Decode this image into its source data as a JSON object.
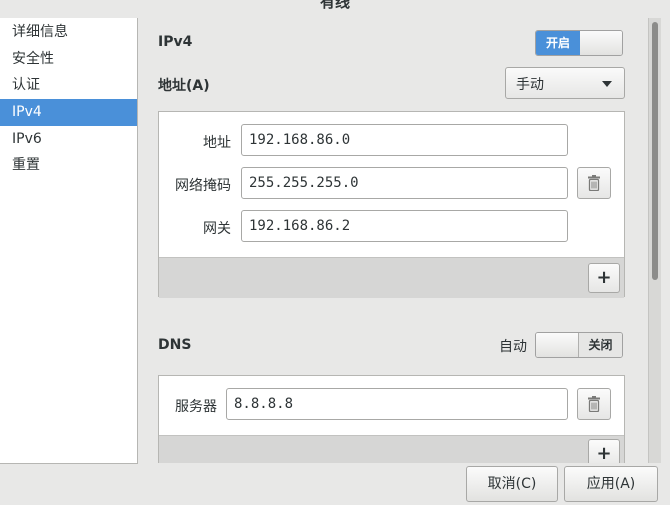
{
  "window": {
    "title": "有线"
  },
  "sidebar": {
    "items": [
      {
        "label": "详细信息",
        "selected": false
      },
      {
        "label": "安全性",
        "selected": false
      },
      {
        "label": "认证",
        "selected": false
      },
      {
        "label": "IPv4",
        "selected": true
      },
      {
        "label": "IPv6",
        "selected": false
      },
      {
        "label": "重置",
        "selected": false
      }
    ]
  },
  "ipv4": {
    "label": "IPv4",
    "toggle_state": "开启",
    "address_method_label": "地址(A)",
    "address_method_value": "手动",
    "fields": [
      {
        "label": "地址",
        "value": "192.168.86.0"
      },
      {
        "label": "网络掩码",
        "value": "255.255.255.0"
      },
      {
        "label": "网关",
        "value": "192.168.86.2"
      }
    ]
  },
  "dns": {
    "label": "DNS",
    "auto_label": "自动",
    "toggle_state": "关闭",
    "server_label": "服务器",
    "server_value": "8.8.8.8"
  },
  "buttons": {
    "cancel": "取消(C)",
    "apply": "应用(A)"
  },
  "colors": {
    "accent": "#4a90d9",
    "background": "#e8e8e7"
  }
}
